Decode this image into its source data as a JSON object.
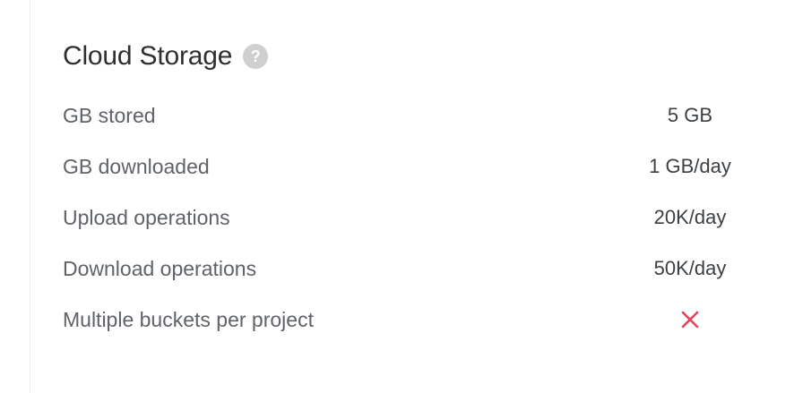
{
  "section": {
    "title": "Cloud Storage",
    "help_symbol": "?"
  },
  "rows": [
    {
      "label": "GB stored",
      "value": "5 GB"
    },
    {
      "label": "GB downloaded",
      "value": "1 GB/day"
    },
    {
      "label": "Upload operations",
      "value": "20K/day"
    },
    {
      "label": "Download operations",
      "value": "50K/day"
    },
    {
      "label": "Multiple buckets per project",
      "value_icon": "cross-icon"
    }
  ],
  "colors": {
    "cross": "#e8435a",
    "help_bg": "#cfcfcf"
  }
}
